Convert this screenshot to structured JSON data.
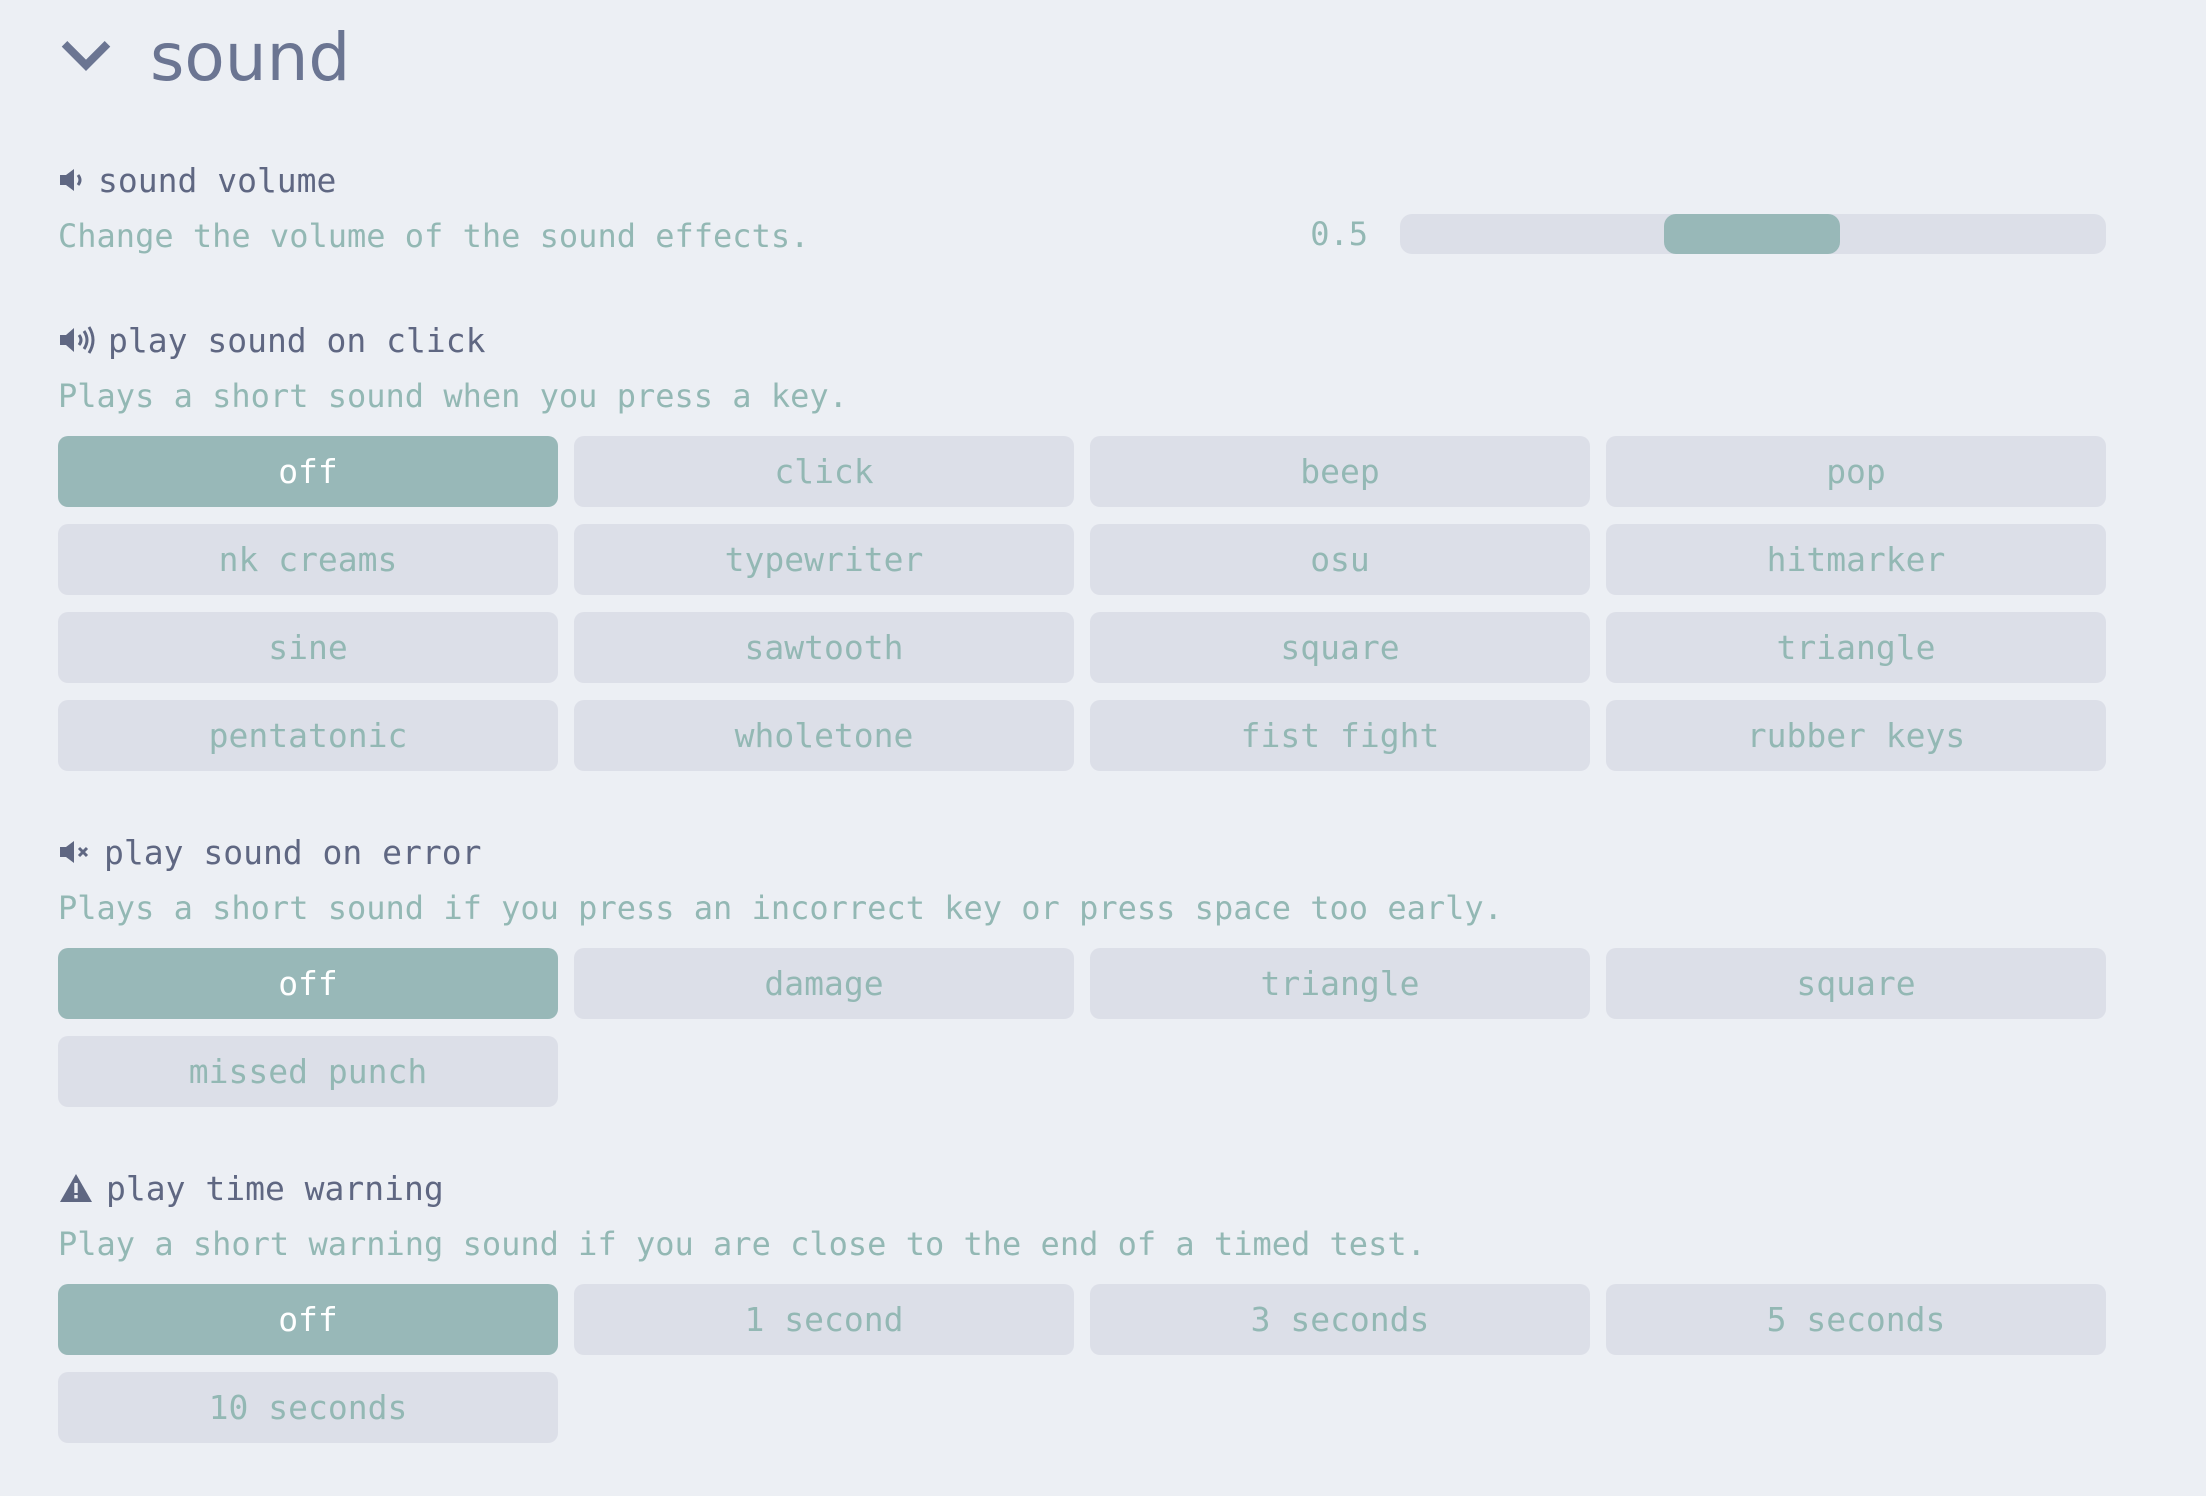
{
  "section": {
    "title": "sound",
    "icon": "chevron-down-icon"
  },
  "sound_volume": {
    "title": "sound volume",
    "icon": "volume-low-icon",
    "description": "Change the volume of the sound effects.",
    "value_label": "0.5",
    "value": 0.5
  },
  "play_sound_on_click": {
    "title": "play sound on click",
    "icon": "volume-high-icon",
    "description": "Plays a short sound when you press a key.",
    "selected": "off",
    "options": [
      "off",
      "click",
      "beep",
      "pop",
      "nk creams",
      "typewriter",
      "osu",
      "hitmarker",
      "sine",
      "sawtooth",
      "square",
      "triangle",
      "pentatonic",
      "wholetone",
      "fist fight",
      "rubber keys"
    ]
  },
  "play_sound_on_error": {
    "title": "play sound on error",
    "icon": "volume-mute-icon",
    "description": "Plays a short sound if you press an incorrect key or press space too early.",
    "selected": "off",
    "options": [
      "off",
      "damage",
      "triangle",
      "square",
      "missed punch"
    ]
  },
  "play_time_warning": {
    "title": "play time warning",
    "icon": "warning-icon",
    "description": "Play a short warning sound if you are close to the end of a timed test.",
    "selected": "off",
    "options": [
      "off",
      "1 second",
      "3 seconds",
      "5 seconds",
      "10 seconds"
    ]
  },
  "colors": {
    "background": "#eceff4",
    "button": "#dcdfe8",
    "accent": "#98b8b8",
    "text": "#5f6782",
    "subtext": "#93b8b4"
  }
}
